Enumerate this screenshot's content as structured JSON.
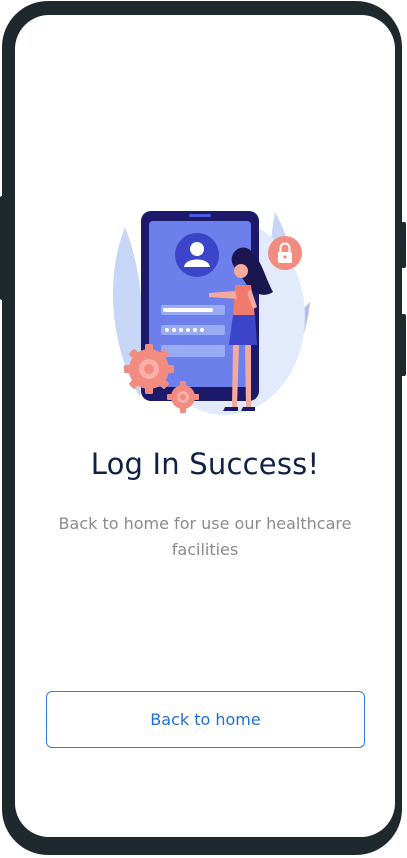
{
  "success": {
    "title": "Log In Success!",
    "subtitle": "Back to home for use our healthcare facilities",
    "illustration_icon": "login-success-illustration"
  },
  "actions": {
    "back_label": "Back to home"
  },
  "colors": {
    "frame": "#1f282d",
    "title": "#102145",
    "subtitle": "#8b8b8b",
    "accent": "#1d6fd0"
  }
}
